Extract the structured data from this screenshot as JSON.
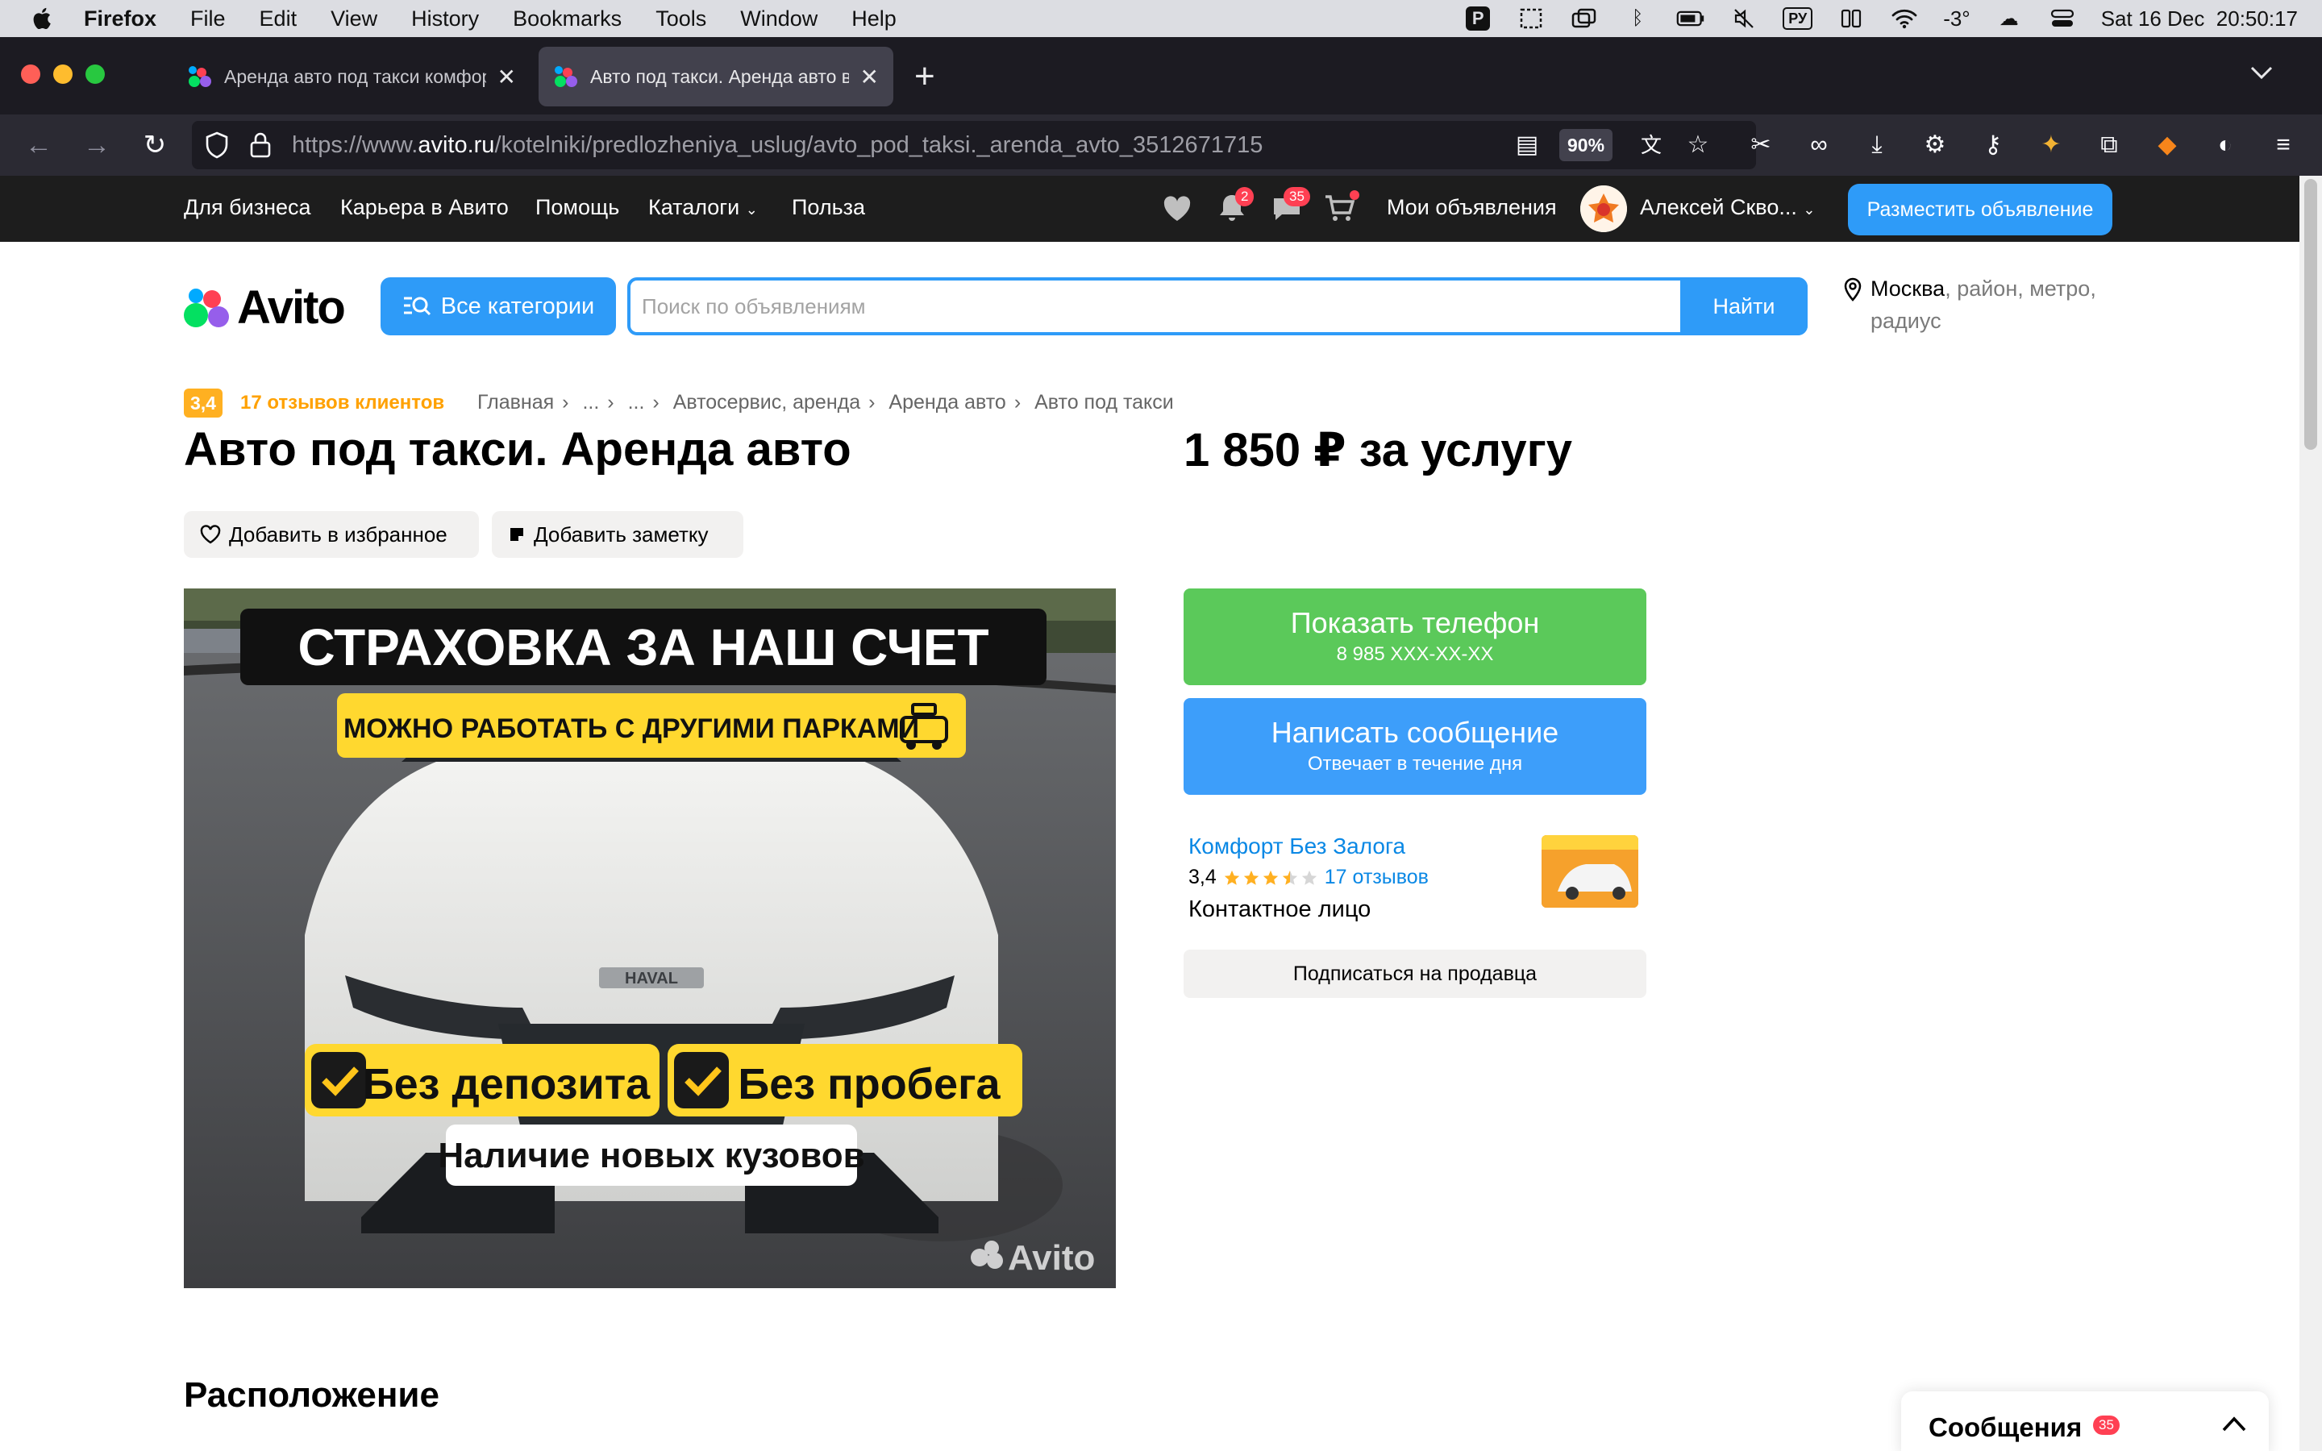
{
  "menubar": {
    "app": "Firefox",
    "items": [
      "File",
      "Edit",
      "View",
      "History",
      "Bookmarks",
      "Tools",
      "Window",
      "Help"
    ],
    "input_source": "РУ",
    "temperature": "-3°",
    "datetime": "Sat 16 Dec  20:50:17"
  },
  "tabs": [
    {
      "title": "Аренда авто под такси комфорт",
      "active": false
    },
    {
      "title": "Авто под такси. Аренда авто в",
      "active": true
    }
  ],
  "urlbar": {
    "prefix": "https://www.",
    "domain": "avito.ru",
    "path": "/kotelniki/predlozheniya_uslug/avto_pod_taksi._arenda_avto_3512671715",
    "zoom": "90%"
  },
  "topnav": {
    "links": [
      "Для бизнеса",
      "Карьера в Авито",
      "Помощь",
      "Каталоги",
      "Польза"
    ],
    "notifications_count": "2",
    "messages_count": "35",
    "my_ads": "Мои объявления",
    "user_name": "Алексей Скво...",
    "post_button": "Разместить объявление"
  },
  "header": {
    "logo_text": "Avito",
    "categories_button": "Все категории",
    "search_placeholder": "Поиск по объявлениям",
    "search_button": "Найти",
    "location_city": "Москва",
    "location_rest": ", район, метро, радиус"
  },
  "listing": {
    "rating": "3,4",
    "reviews_link": "17 отзывов клиентов",
    "breadcrumbs": [
      "Главная",
      "...",
      "...",
      "Автосервис, аренда",
      "Аренда авто",
      "Авто под такси"
    ],
    "title": "Авто под такси. Аренда авто",
    "price": "1 850 ₽ за услугу",
    "fav_button": "Добавить в избранное",
    "note_button": "Добавить заметку",
    "photo": {
      "banner_top": "СТРАХОВКА ЗА НАШ СЧЕТ",
      "banner_sub": "МОЖНО РАБОТАТЬ С ДРУГИМИ ПАРКАМИ",
      "badge_left": "Без депозита",
      "badge_right": "Без пробега",
      "badge_bottom": "Наличие новых кузовов",
      "grille_brand": "HAVAL",
      "watermark": "Avito"
    }
  },
  "contact": {
    "phone_button": "Показать телефон",
    "phone_masked": "8 985 XXX-XX-XX",
    "message_button": "Написать сообщение",
    "message_sub": "Отвечает в течение дня",
    "seller_name": "Комфорт Без Залога",
    "seller_rating": "3,4",
    "seller_stars": 3.4,
    "seller_reviews": "17 отзывов",
    "contact_person": "Контактное лицо",
    "subscribe_button": "Подписаться на продавца"
  },
  "sections": {
    "location_title": "Расположение"
  },
  "messages_panel": {
    "label": "Сообщения",
    "count": "35"
  },
  "colors": {
    "avito_blue": "#2e9bf8",
    "green": "#5bc95a",
    "rating_orange": "#ffb021",
    "badge_red": "#ff4053"
  }
}
